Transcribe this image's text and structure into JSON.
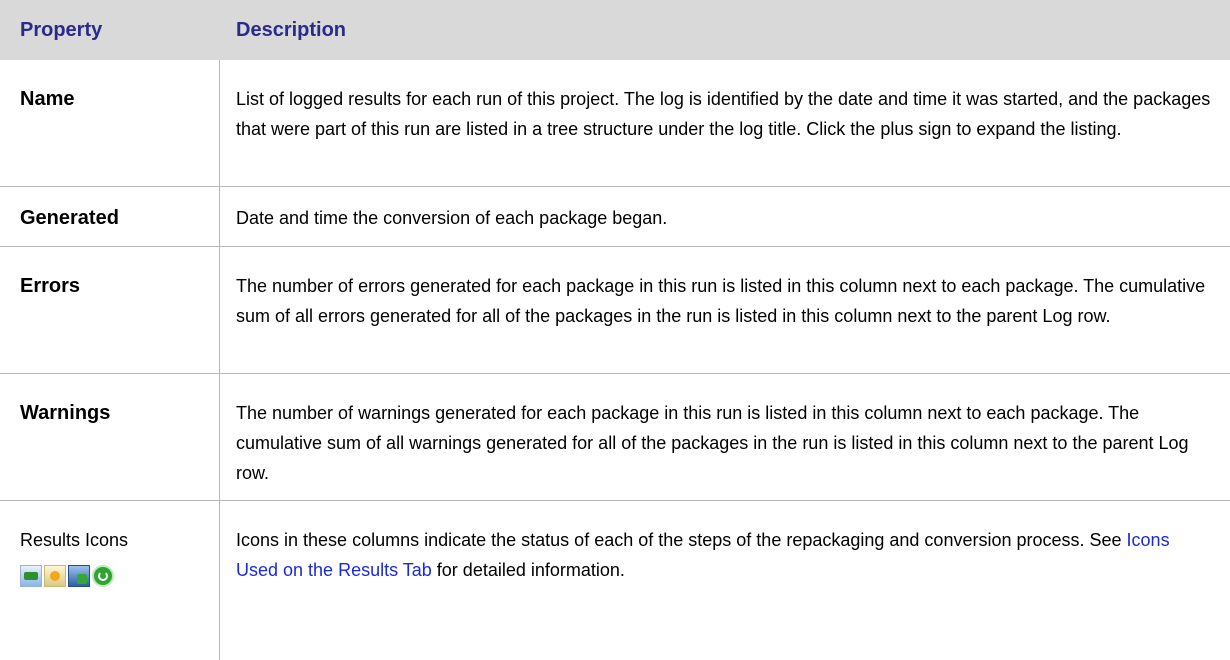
{
  "header": {
    "property": "Property",
    "description": "Description"
  },
  "rows": [
    {
      "property": "Name",
      "description": "List of logged results for each run of this project. The log is identified by the date and time it was started, and the packages that were part of this run are listed in a tree structure under the log title. Click the plus sign to expand the listing."
    },
    {
      "property": "Generated",
      "description": "Date and time the conversion of each package began."
    },
    {
      "property": "Errors",
      "description": "The number of errors generated for each package in this run is listed in this column next to each package. The cumulative sum of all errors generated for all of the packages in the run is listed in this column next to the parent Log row."
    },
    {
      "property": "Warnings",
      "description": "The number of warnings generated for each package in this run is listed in this column next to each package. The cumulative sum of all warnings generated for all of the packages in the run is listed in this column next to the parent Log row."
    },
    {
      "property": "Results Icons",
      "icons": [
        "monitor-green-icon",
        "monitor-yellow-icon",
        "monitor-blue-icon",
        "refresh-green-icon"
      ],
      "description_pre": "Icons in these columns indicate the status of each of the steps of the repackaging and conversion process. See ",
      "description_link": "Icons Used on the Results Tab",
      "description_post": " for detailed information."
    }
  ]
}
